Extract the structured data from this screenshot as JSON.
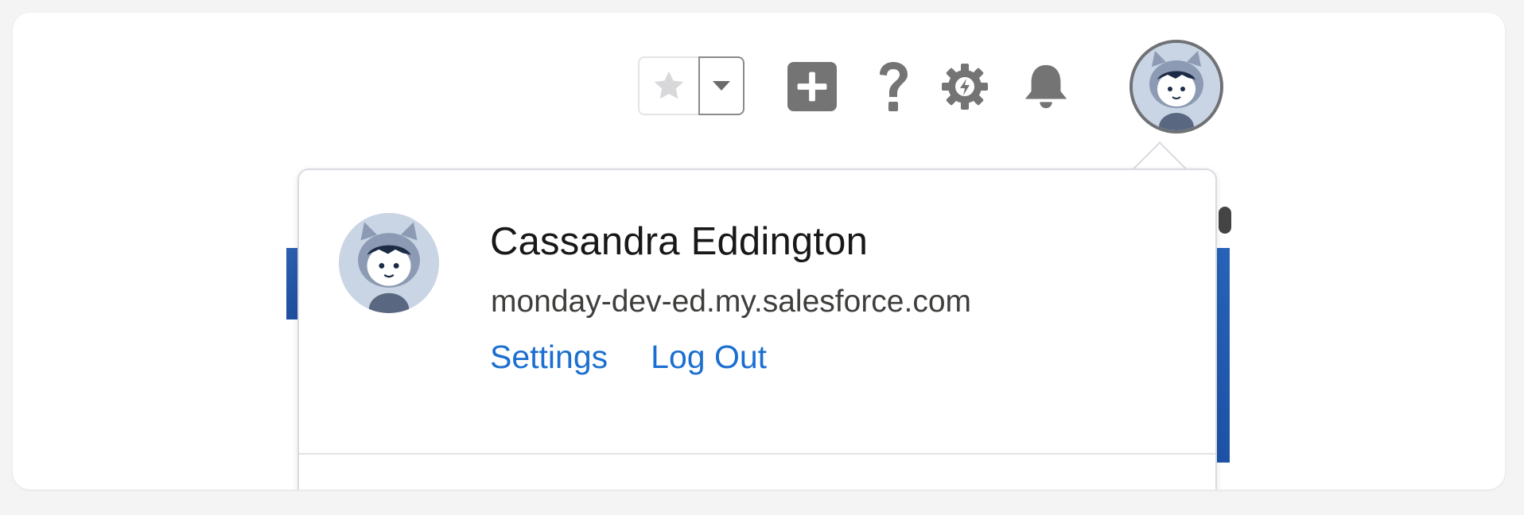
{
  "header": {
    "favorites": {
      "star_icon": "star-icon",
      "dropdown_icon": "caret-down-icon"
    },
    "icons": [
      {
        "name": "global-actions-icon",
        "glyph": "plus"
      },
      {
        "name": "help-icon",
        "glyph": "question-mark"
      },
      {
        "name": "setup-gear-icon",
        "glyph": "gear-with-lightning"
      },
      {
        "name": "notifications-icon",
        "glyph": "bell"
      }
    ],
    "avatar_icon": "user-avatar-icon"
  },
  "popover": {
    "user_name": "Cassandra Eddington",
    "domain": "monday-dev-ed.my.salesforce.com",
    "links": {
      "settings": "Settings",
      "logout": "Log Out"
    }
  },
  "colors": {
    "link": "#1b6fd0",
    "icon_gray": "#747474",
    "avatar_blue": "#c9d4e4",
    "header_blue": "#2a5fb0"
  }
}
